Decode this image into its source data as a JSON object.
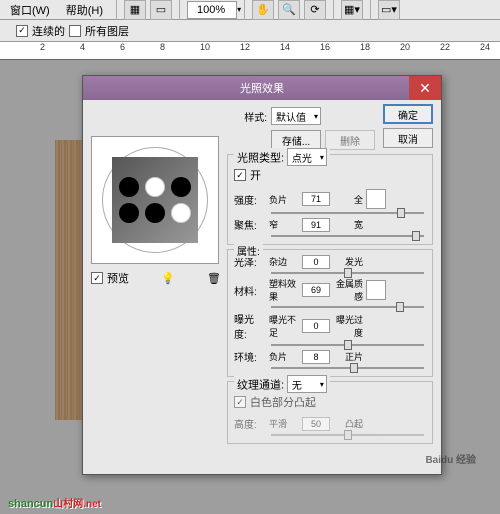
{
  "menubar": {
    "window": "窗口(W)",
    "help": "帮助(H)"
  },
  "toolbar": {
    "zoom": "100%"
  },
  "optbar": {
    "continuous": "✓",
    "continuous_label": "连续的",
    "alllayers_label": "所有图层"
  },
  "ruler": {
    "ticks": [
      "2",
      "4",
      "6",
      "8",
      "10",
      "12",
      "14",
      "16",
      "18",
      "20",
      "22",
      "24"
    ]
  },
  "dialog": {
    "title": "光照效果",
    "buttons": {
      "ok": "确定",
      "cancel": "取消",
      "save": "存储...",
      "delete": "删除"
    },
    "style_label": "样式:",
    "style_value": "默认值",
    "preview_cb": "预览",
    "lighttype": {
      "legend": "光照类型:",
      "value": "点光",
      "on_cb": "开",
      "intensity": {
        "label": "强度:",
        "left": "负片",
        "right": "全",
        "value": "71"
      },
      "focus": {
        "label": "聚焦:",
        "left": "窄",
        "right": "宽",
        "value": "91"
      }
    },
    "props": {
      "legend": "属性:",
      "gloss": {
        "label": "光泽:",
        "left": "杂边",
        "right": "发光",
        "value": "0"
      },
      "material": {
        "label": "材料:",
        "left": "塑料效果",
        "right": "金属质感",
        "value": "69"
      },
      "exposure": {
        "label": "曝光度:",
        "left": "曝光不足",
        "right": "曝光过度",
        "value": "0"
      },
      "ambience": {
        "label": "环境:",
        "left": "负片",
        "right": "正片",
        "value": "8"
      }
    },
    "texture": {
      "legend": "纹理通道:",
      "value": "无",
      "white_high_cb": "白色部分凸起",
      "height": {
        "label": "高度:",
        "left": "平滑",
        "right": "凸起",
        "value": "50"
      }
    }
  },
  "watermarks": {
    "baidu": "Baidu 经验",
    "shancun": "shancun",
    "shancun_suffix": "山村网.net"
  }
}
